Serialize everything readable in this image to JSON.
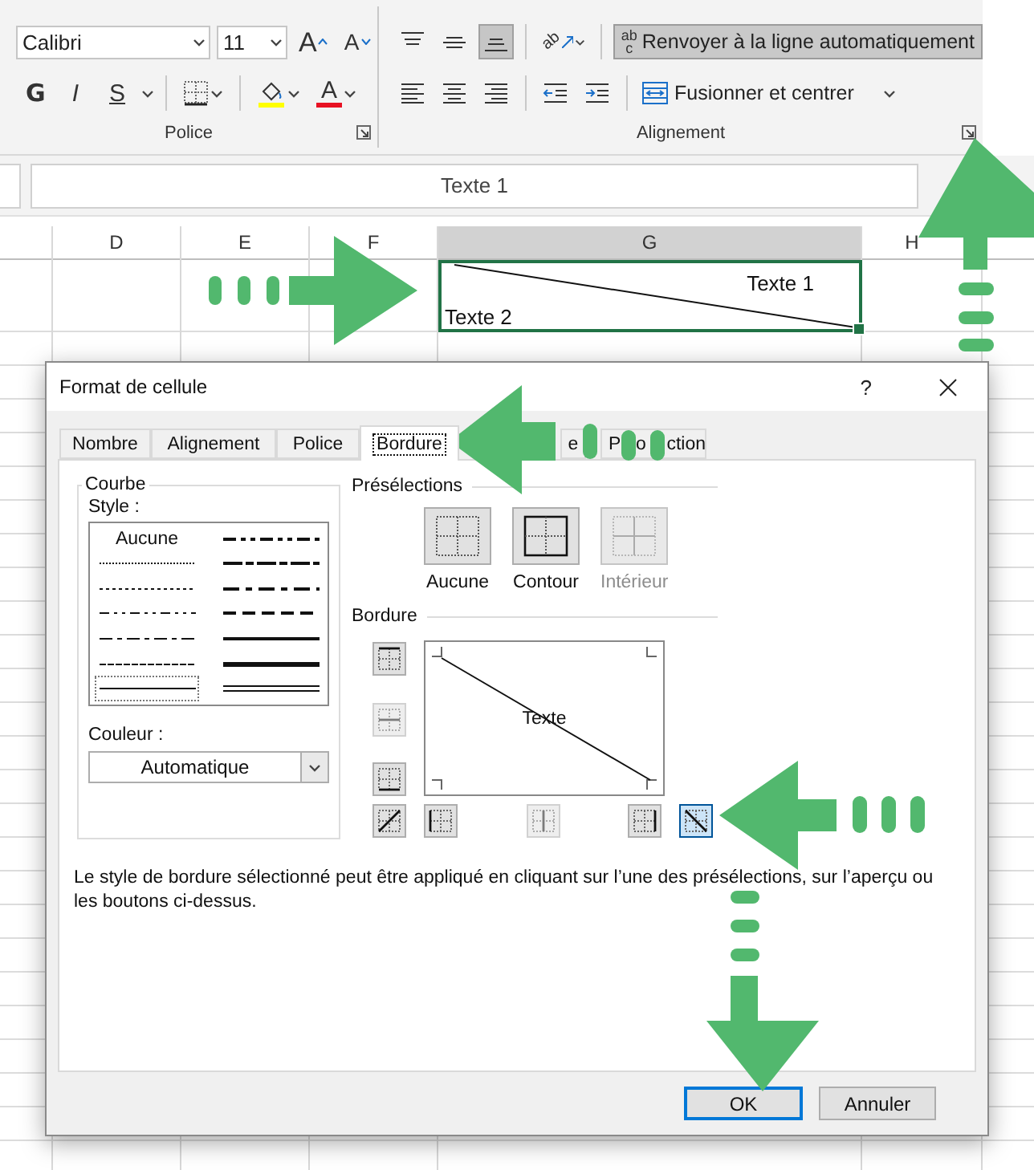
{
  "ribbon": {
    "font_name": "Calibri",
    "font_size": "11",
    "grow_font_glyph": "A",
    "shrink_font_glyph": "A",
    "font_color_glyph": "A",
    "format_buttons": [
      {
        "label": "G",
        "kind": "bold"
      },
      {
        "label": "I",
        "kind": "italic"
      },
      {
        "label": "S",
        "kind": "underline"
      }
    ],
    "groups": [
      {
        "label": "Police"
      },
      {
        "label": "Alignement"
      }
    ],
    "vertical_align": [
      {
        "kind": "top",
        "selected": false
      },
      {
        "kind": "middle",
        "selected": false
      },
      {
        "kind": "bottom",
        "selected": true
      }
    ],
    "orientation_glyph": "ab",
    "wrap_text": {
      "glyph_lines": [
        "ab",
        "c"
      ],
      "label": "Renvoyer à la ligne automatiquement",
      "selected": true
    },
    "merge": {
      "label": "Fusionner et centrer"
    }
  },
  "formula_bar": {
    "value": "Texte 1"
  },
  "sheet": {
    "columns": [
      {
        "label": "D",
        "selected": false
      },
      {
        "label": "E",
        "selected": false
      },
      {
        "label": "F",
        "selected": false
      },
      {
        "label": "G",
        "selected": true
      },
      {
        "label": "H",
        "selected": false
      }
    ],
    "cell": {
      "top_right": "Texte 1",
      "bottom_left": "Texte 2"
    }
  },
  "dialog": {
    "title": "Format de cellule",
    "help": "?",
    "tabs": [
      {
        "label": "Nombre",
        "selected": false
      },
      {
        "label": "Alignement",
        "selected": false
      },
      {
        "label": "Police",
        "selected": false
      },
      {
        "label": "Bordure",
        "selected": true
      },
      {
        "label": "e",
        "selected": false
      },
      {
        "label": "P   o    ction",
        "selected": false
      }
    ],
    "line_group": {
      "title": "Courbe",
      "style_label": "Style :",
      "color_label": "Couleur :",
      "color_value": "Automatique",
      "styles": [
        {
          "kind": "none",
          "label": "Aucune",
          "selected": false
        },
        {
          "kind": "hair",
          "selected": false
        },
        {
          "kind": "dotted",
          "selected": false
        },
        {
          "kind": "dashdotdot",
          "selected": false
        },
        {
          "kind": "dashdot",
          "selected": false
        },
        {
          "kind": "dashed",
          "selected": false
        },
        {
          "kind": "thin",
          "selected": true
        },
        {
          "kind": "medium_dashdotdot",
          "selected": false
        },
        {
          "kind": "slant_dashdot",
          "selected": false
        },
        {
          "kind": "medium_dashdot",
          "selected": false
        },
        {
          "kind": "medium_dashed",
          "selected": false
        },
        {
          "kind": "medium",
          "selected": false
        },
        {
          "kind": "thick",
          "selected": false
        },
        {
          "kind": "double",
          "selected": false
        }
      ]
    },
    "presets_title": "Présélections",
    "presets": [
      {
        "kind": "none",
        "label": "Aucune",
        "disabled": false
      },
      {
        "kind": "outline",
        "label": "Contour",
        "disabled": false
      },
      {
        "kind": "inside",
        "label": "Intérieur",
        "disabled": true
      }
    ],
    "border_title": "Bordure",
    "preview_text": "Texte",
    "border_buttons": [
      {
        "kind": "top",
        "on": false,
        "disabled": false
      },
      {
        "kind": "middle_h",
        "on": false,
        "disabled": true
      },
      {
        "kind": "bottom",
        "on": false,
        "disabled": false
      },
      {
        "kind": "diag_up",
        "on": false,
        "disabled": false
      },
      {
        "kind": "left",
        "on": false,
        "disabled": false
      },
      {
        "kind": "middle_v",
        "on": false,
        "disabled": true
      },
      {
        "kind": "right",
        "on": false,
        "disabled": false
      },
      {
        "kind": "diag_down",
        "on": true,
        "disabled": false
      }
    ],
    "hint": "Le style de bordure sélectionné peut être appliqué en cliquant sur l’une des présélections, sur l’aperçu ou les boutons ci-dessus.",
    "buttons": [
      {
        "label": "OK",
        "default": true
      },
      {
        "label": "Annuler",
        "default": false
      }
    ]
  }
}
